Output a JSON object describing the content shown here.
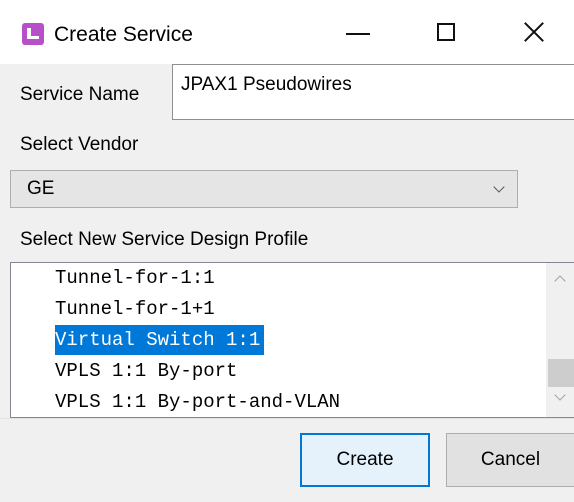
{
  "window": {
    "title": "Create Service",
    "icon": "app-icon",
    "controls": [
      "minimize",
      "maximize",
      "close"
    ]
  },
  "service_name": {
    "label": "Service Name",
    "value": "JPAX1 Pseudowires"
  },
  "vendor": {
    "label": "Select Vendor",
    "selected": "GE"
  },
  "profile": {
    "label": "Select New Service Design Profile",
    "items": [
      "Tunnel-for-1:1",
      "Tunnel-for-1+1",
      "Virtual Switch 1:1",
      "VPLS 1:1 By-port",
      "VPLS 1:1 By-port-and-VLAN"
    ],
    "selected_index": 2
  },
  "buttons": {
    "create": "Create",
    "cancel": "Cancel"
  },
  "colors": {
    "selection": "#0078d7",
    "default_button_border": "#0078d7"
  }
}
